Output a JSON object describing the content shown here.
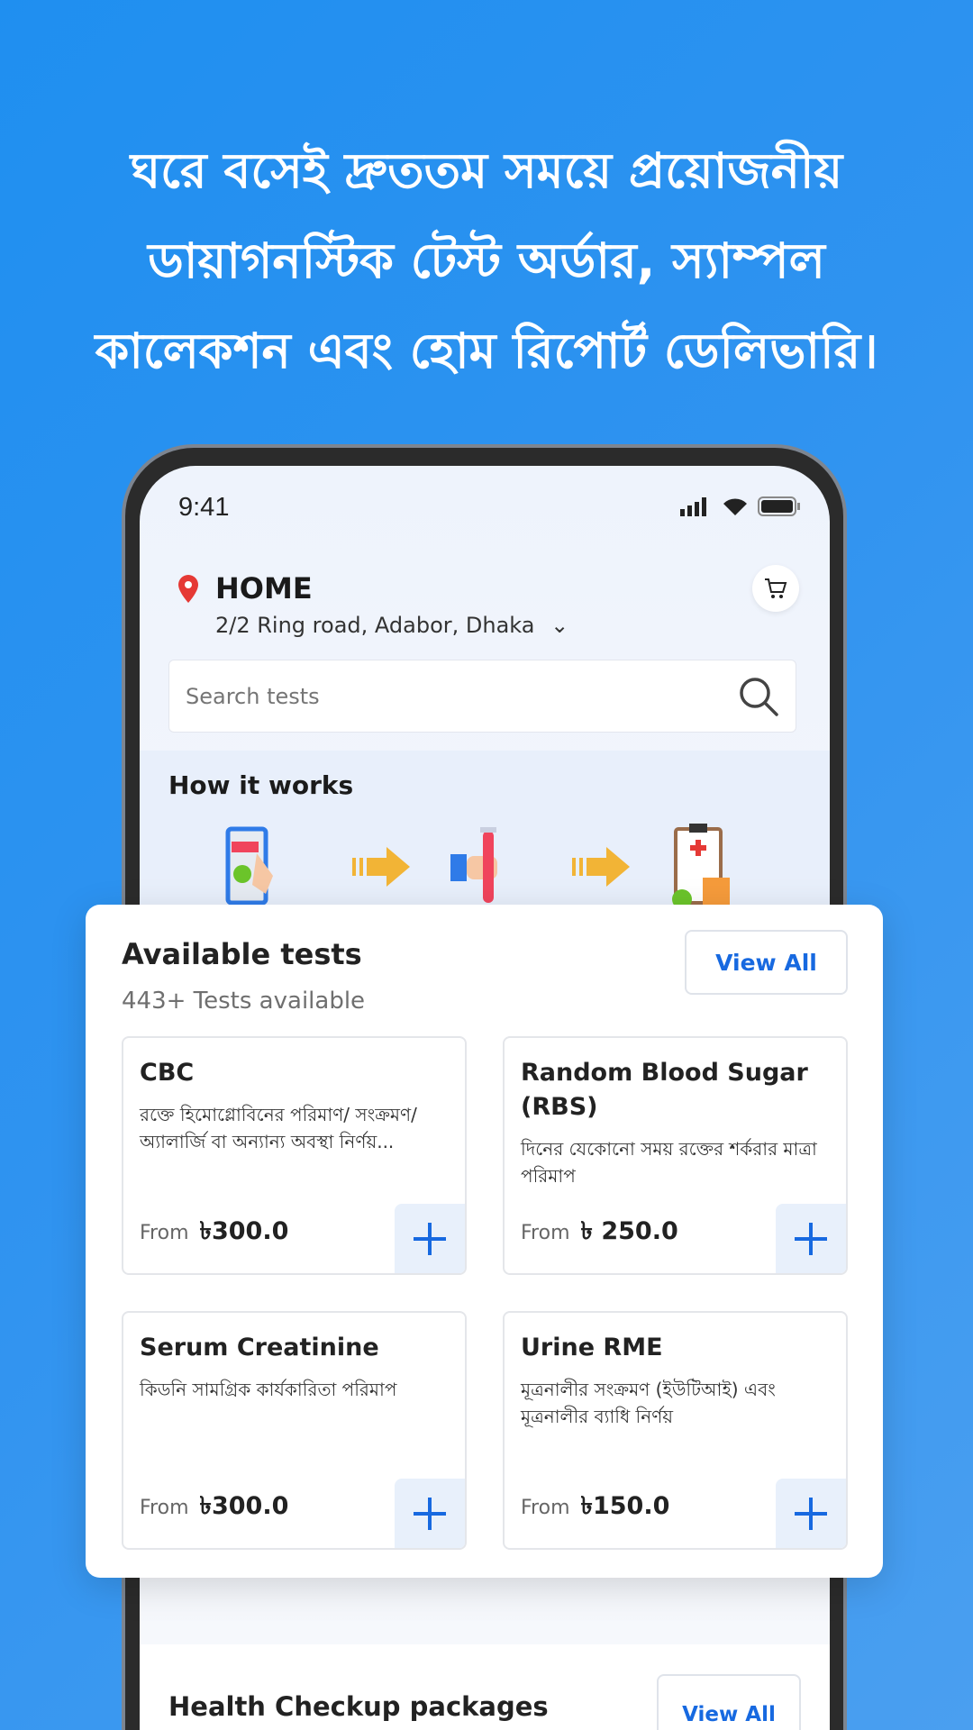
{
  "headline": [
    "ঘরে বসেই দ্রুততম সময়ে প্রয়োজনীয়",
    "ডায়াগনস্টিক টেস্ট অর্ডার, স্যাম্পল",
    "কালেকশন এবং হোম রিপোর্ট ডেলিভারি।"
  ],
  "status": {
    "time": "9:41"
  },
  "location": {
    "label": "HOME",
    "address": "2/2 Ring road, Adabor, Dhaka"
  },
  "search": {
    "placeholder": "Search tests"
  },
  "how_it_works": {
    "title": "How it works",
    "steps": [
      "order-on-phone-icon",
      "sample-collection-icon",
      "report-delivery-icon"
    ]
  },
  "available": {
    "title": "Available tests",
    "count": "443+ Tests available",
    "view_all": "View All",
    "tests": [
      {
        "name": "CBC",
        "desc": "রক্তে হিমোগ্লোবিনের পরিমাণ/ সংক্রমণ/অ্যালার্জি বা অন্যান্য অবস্থা নির্ণয়...",
        "from": "From",
        "price": "৳300.0"
      },
      {
        "name": "Random Blood Sugar (RBS)",
        "desc": "দিনের যেকোনো সময় রক্তের শর্করার মাত্রা পরিমাপ",
        "from": "From",
        "price": "৳ 250.0"
      },
      {
        "name": "Serum Creatinine",
        "desc": "কিডনি সামগ্রিক কার্যকারিতা পরিমাপ",
        "from": "From",
        "price": "৳300.0"
      },
      {
        "name": "Urine RME",
        "desc": "মূত্রনালীর সংক্রমণ (ইউটিআই) এবং মূত্রনালীর ব্যাধি নির্ণয়",
        "from": "From",
        "price": "৳150.0"
      }
    ]
  },
  "health_checkup": {
    "title": "Health Checkup packages",
    "view_all": "View All"
  },
  "colors": {
    "background": "#2f93f0",
    "accent": "#1769e0",
    "location_pin": "#e53935"
  }
}
